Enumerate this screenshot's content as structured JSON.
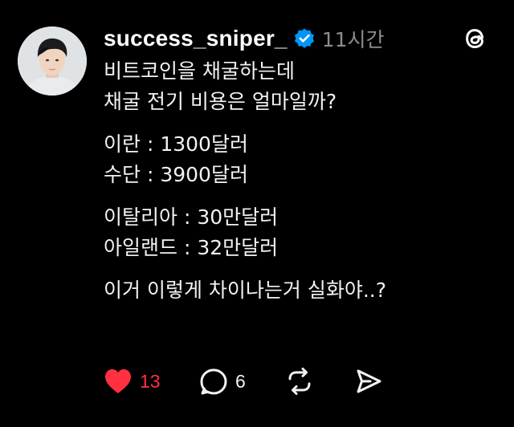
{
  "post": {
    "username": "success_sniper_",
    "time_ago": "11시간",
    "paragraphs": [
      {
        "lines": [
          "비트코인을 채굴하는데",
          "채굴 전기 비용은 얼마일까?"
        ]
      },
      {
        "lines": [
          "이란 : 1300달러",
          "수단 : 3900달러"
        ]
      },
      {
        "lines": [
          "이탈리아 : 30만달러",
          "아일랜드 : 32만달러"
        ]
      },
      {
        "lines": [
          "이거 이렇게 차이나는거 실화야..?"
        ]
      }
    ],
    "likes": "13",
    "replies": "6",
    "liked": true
  },
  "icons": {
    "avatar": "profile-photo",
    "verified": "verified-badge-icon",
    "app": "threads-logo-icon",
    "like": "heart-icon",
    "reply": "speech-bubble-icon",
    "repost": "repost-icon",
    "share": "send-icon"
  },
  "colors": {
    "background": "#000000",
    "text": "#f2f2f2",
    "muted": "#8c8c8c",
    "like": "#ff3040",
    "verified": "#0095f6"
  }
}
